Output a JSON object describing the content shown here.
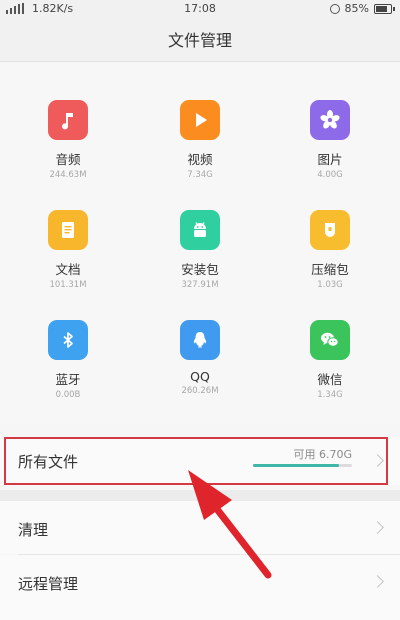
{
  "status_bar": {
    "network_speed": "1.82K/s",
    "time": "17:08",
    "battery_percent": "85%"
  },
  "header": {
    "title": "文件管理"
  },
  "categories": [
    {
      "name": "音频",
      "size": "244.63M",
      "icon": "music-note-icon",
      "color": "#ef5b5b"
    },
    {
      "name": "视频",
      "size": "7.34G",
      "icon": "play-icon",
      "color": "#fb8d20"
    },
    {
      "name": "图片",
      "size": "4.00G",
      "icon": "flower-icon",
      "color": "#8d6ae8"
    },
    {
      "name": "文档",
      "size": "101.31M",
      "icon": "document-icon",
      "color": "#f8b62c"
    },
    {
      "name": "安装包",
      "size": "327.91M",
      "icon": "android-icon",
      "color": "#2fcfa0"
    },
    {
      "name": "压缩包",
      "size": "1.03G",
      "icon": "zip-icon",
      "color": "#f8bd2e"
    },
    {
      "name": "蓝牙",
      "size": "0.00B",
      "icon": "bluetooth-icon",
      "color": "#3fa2f0"
    },
    {
      "name": "QQ",
      "size": "260.26M",
      "icon": "qq-penguin-icon",
      "color": "#3f9af0"
    },
    {
      "name": "微信",
      "size": "1.34G",
      "icon": "wechat-icon",
      "color": "#3cc45c"
    }
  ],
  "all_files": {
    "label": "所有文件",
    "available_text": "可用 6.70G",
    "used_fraction": 0.87,
    "bar_color": "#3fb7a6"
  },
  "menu": [
    {
      "label": "清理"
    },
    {
      "label": "远程管理"
    }
  ],
  "annotation_color": "#e0242c"
}
